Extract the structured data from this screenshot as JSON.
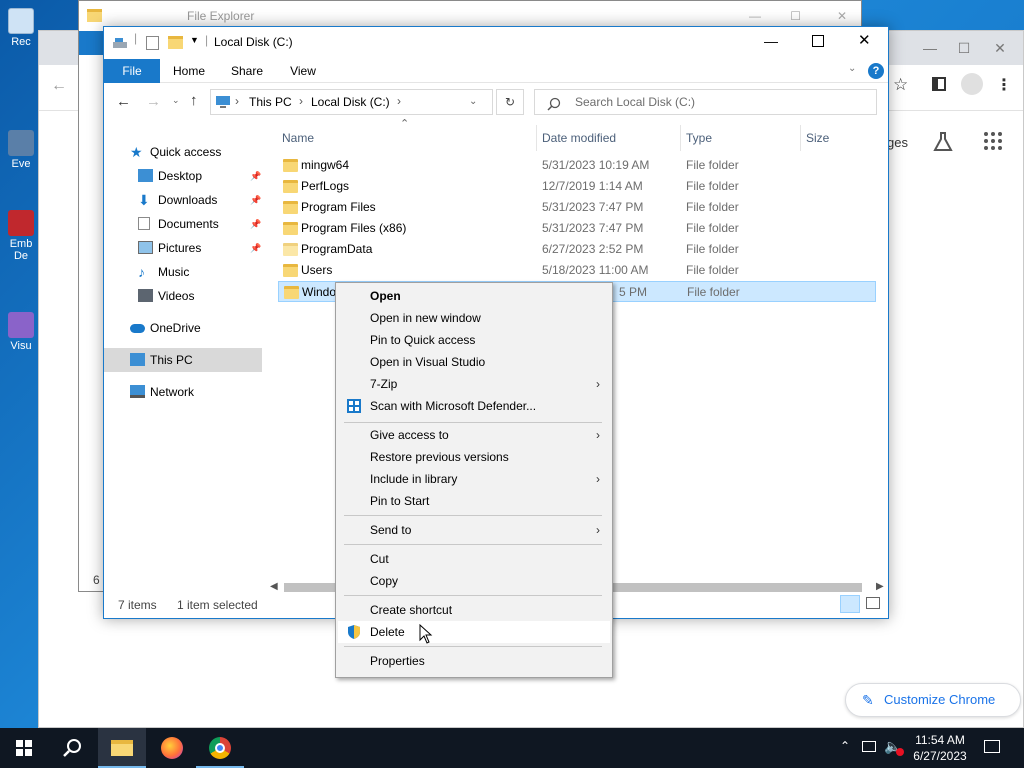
{
  "desktop": {
    "icons": [
      {
        "label": "Rec",
        "name": "recycle-bin"
      },
      {
        "label": "Eve",
        "name": "event-viewer"
      },
      {
        "label": "Emb\nDe",
        "name": "embedded-app"
      },
      {
        "label": "Visu",
        "name": "visual-studio"
      }
    ]
  },
  "chrome": {
    "partial_text": "ges",
    "customize_label": "Customize Chrome"
  },
  "explorer_back": {
    "title": "File Explorer",
    "status_partial": "6 i"
  },
  "explorer": {
    "title": "Local Disk (C:)",
    "ribbon_tabs": [
      "File",
      "Home",
      "Share",
      "View"
    ],
    "breadcrumb": [
      "This PC",
      "Local Disk (C:)"
    ],
    "search_placeholder": "Search Local Disk (C:)",
    "nav": {
      "quick_access": "Quick access",
      "items": [
        {
          "label": "Desktop",
          "pinned": true
        },
        {
          "label": "Downloads",
          "pinned": true
        },
        {
          "label": "Documents",
          "pinned": true
        },
        {
          "label": "Pictures",
          "pinned": true
        },
        {
          "label": "Music",
          "pinned": false
        },
        {
          "label": "Videos",
          "pinned": false
        }
      ],
      "onedrive": "OneDrive",
      "this_pc": "This PC",
      "network": "Network"
    },
    "columns": {
      "name": "Name",
      "date": "Date modified",
      "type": "Type",
      "size": "Size"
    },
    "files": [
      {
        "name": "mingw64",
        "date": "5/31/2023 10:19 AM",
        "type": "File folder"
      },
      {
        "name": "PerfLogs",
        "date": "12/7/2019 1:14 AM",
        "type": "File folder"
      },
      {
        "name": "Program Files",
        "date": "5/31/2023 7:47 PM",
        "type": "File folder"
      },
      {
        "name": "Program Files (x86)",
        "date": "5/31/2023 7:47 PM",
        "type": "File folder"
      },
      {
        "name": "ProgramData",
        "date": "6/27/2023 2:52 PM",
        "type": "File folder"
      },
      {
        "name": "Users",
        "date": "5/18/2023 11:00 AM",
        "type": "File folder"
      },
      {
        "name": "Windo",
        "date": "5 PM",
        "type": "File folder"
      }
    ],
    "status": {
      "items": "7 items",
      "selected": "1 item selected"
    }
  },
  "context_menu": {
    "items": [
      {
        "label": "Open",
        "bold": true
      },
      {
        "label": "Open in new window"
      },
      {
        "label": "Pin to Quick access"
      },
      {
        "label": "Open in Visual Studio"
      },
      {
        "label": "7-Zip",
        "submenu": true
      },
      {
        "label": "Scan with Microsoft Defender...",
        "icon": "defender-icon"
      },
      {
        "label": "Give access to",
        "submenu": true
      },
      {
        "label": "Restore previous versions"
      },
      {
        "label": "Include in library",
        "submenu": true
      },
      {
        "label": "Pin to Start"
      },
      {
        "label": "Send to",
        "submenu": true
      },
      {
        "label": "Cut"
      },
      {
        "label": "Copy"
      },
      {
        "label": "Create shortcut"
      },
      {
        "label": "Delete",
        "icon": "shield-icon",
        "hover": true
      },
      {
        "label": "Properties"
      }
    ]
  },
  "taskbar": {
    "time": "11:54 AM",
    "date": "6/27/2023"
  }
}
